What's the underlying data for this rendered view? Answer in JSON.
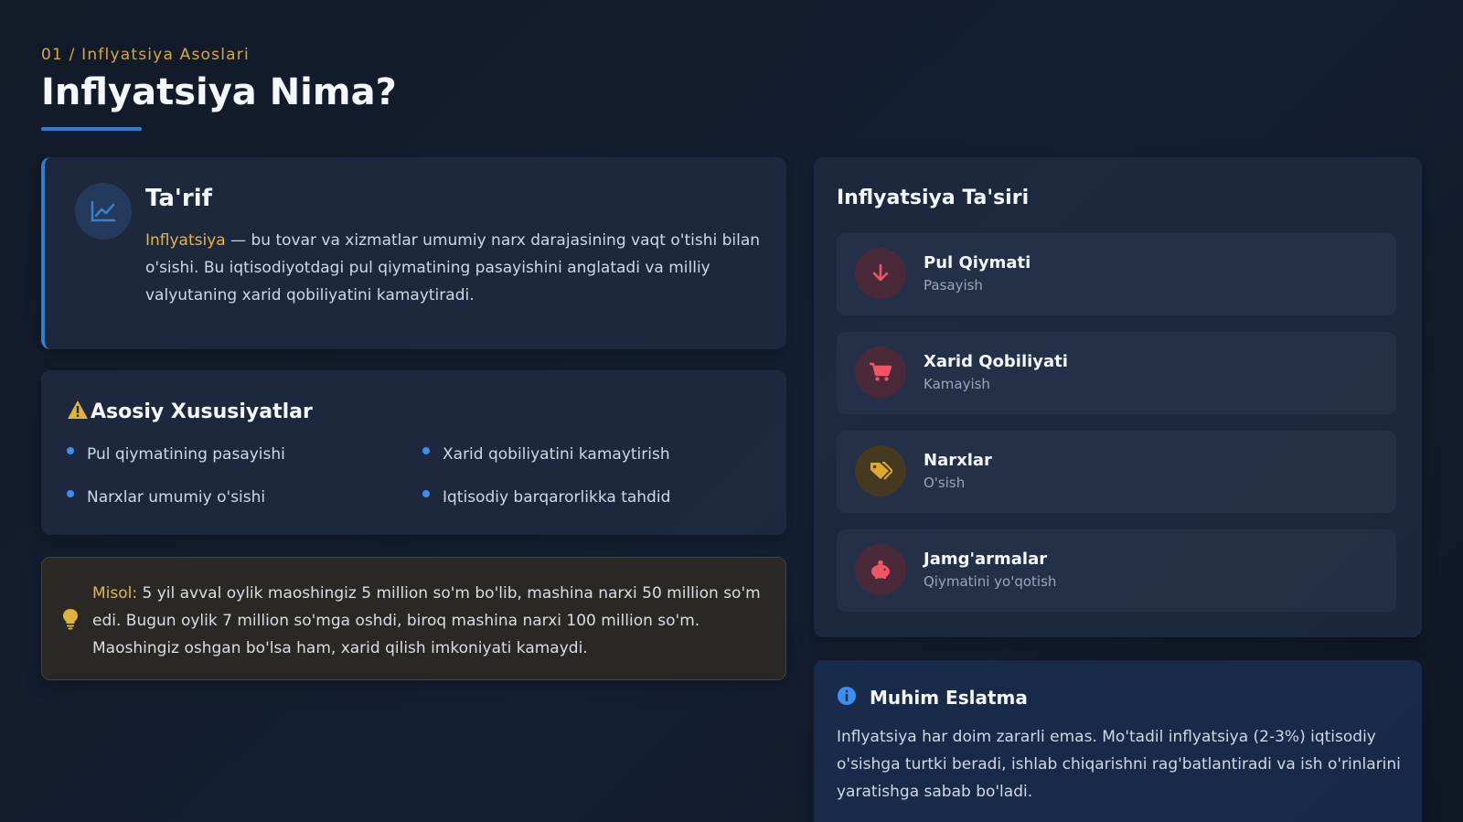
{
  "header": {
    "breadcrumb": "01 / Inflyatsiya Asoslari",
    "title": "Inflyatsiya Nima?"
  },
  "definition": {
    "title": "Ta'rif",
    "icon": "line-chart-icon",
    "highlight": "Inflyatsiya",
    "text": " — bu tovar va xizmatlar umumiy narx darajasining vaqt o'tishi bilan o'sishi. Bu iqtisodiyotdagi pul qiymatining pasayishini anglatadi va milliy valyutaning xarid qobiliyatini kamaytiradi."
  },
  "features": {
    "title": "Asosiy Xususiyatlar",
    "icon": "warning-icon",
    "items": [
      "Pul qiymatining pasayishi",
      "Xarid qobiliyatini kamaytirish",
      "Narxlar umumiy o'sishi",
      "Iqtisodiy barqarorlikka tahdid"
    ]
  },
  "example": {
    "label": "Misol:",
    "icon": "lightbulb-icon",
    "text": " 5 yil avval oylik maoshingiz 5 million so'm bo'lib, mashina narxi 50 million so'm edi. Bugun oylik 7 million so'mga oshdi, biroq mashina narxi 100 million so'm. Maoshingiz oshgan bo'lsa ham, xarid qilish imkoniyati kamaydi."
  },
  "impact": {
    "title": "Inflyatsiya Ta'siri",
    "items": [
      {
        "label": "Pul Qiymati",
        "sub": "Pasayish",
        "icon": "arrow-down-icon",
        "color": "#e04a5a"
      },
      {
        "label": "Xarid Qobiliyati",
        "sub": "Kamayish",
        "icon": "cart-icon",
        "color": "#e04a5a"
      },
      {
        "label": "Narxlar",
        "sub": "O'sish",
        "icon": "tags-icon",
        "color": "#e0a830"
      },
      {
        "label": "Jamg'armalar",
        "sub": "Qiymatini yo'qotish",
        "icon": "piggy-bank-icon",
        "color": "#e04a5a"
      }
    ]
  },
  "note": {
    "title": "Muhim Eslatma",
    "icon": "info-icon",
    "text": "Inflyatsiya har doim zararli emas. Mo'tadil inflyatsiya (2-3%) iqtisodiy o'sishga turtki beradi, ishlab chiqarishni rag'batlantiradi va ish o'rinlarini yaratishga sabab bo'ladi."
  },
  "colors": {
    "accent": "#2f7fd6",
    "highlight": "#e9b53c",
    "danger": "#e04a5a",
    "warning": "#e0a830"
  }
}
